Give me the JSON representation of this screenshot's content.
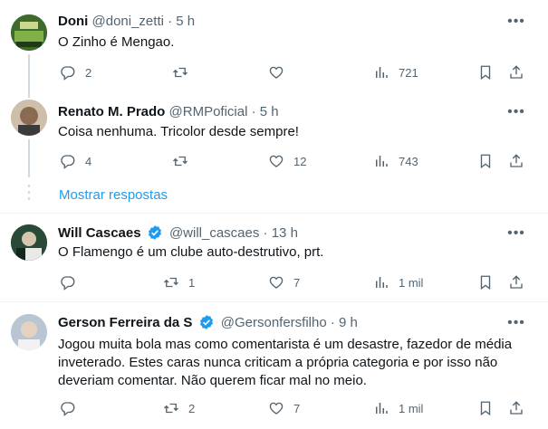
{
  "tweets": [
    {
      "name": "Doni",
      "handle": "@doni_zetti",
      "time": "5 h",
      "text": "O Zinho é Mengao.",
      "replies": "2",
      "retweets": "",
      "likes": "",
      "views": "721"
    },
    {
      "name": "Renato M. Prado",
      "handle": "@RMPoficial",
      "time": "5 h",
      "text": "Coisa nenhuma. Tricolor desde sempre!",
      "replies": "4",
      "retweets": "",
      "likes": "12",
      "views": "743"
    },
    {
      "name": "Will Cascaes",
      "handle": "@will_cascaes",
      "time": "13 h",
      "text": "O Flamengo é um clube auto-destrutivo, prt.",
      "replies": "",
      "retweets": "1",
      "likes": "7",
      "views": "1 mil"
    },
    {
      "name": "Gerson Ferreira da S",
      "handle": "@Gersonfersfilho",
      "time": "9 h",
      "text": "Jogou muita bola mas como comentarista é um desastre, fazedor de média inveterado. Estes caras nunca criticam a própria categoria e por isso não deveriam comentar. Não querem ficar mal no meio.",
      "replies": "",
      "retweets": "2",
      "likes": "7",
      "views": "1 mil"
    }
  ],
  "show_replies_label": "Mostrar respostas",
  "separator": "·",
  "colors": {
    "accent": "#1d9bf0",
    "secondary_text": "#536471",
    "text": "#0f1419"
  }
}
